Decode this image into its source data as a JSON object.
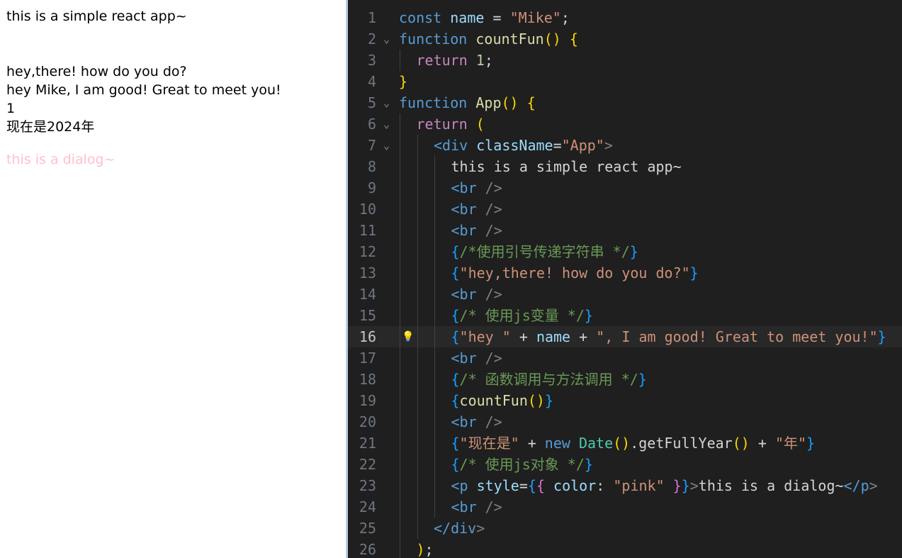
{
  "preview": {
    "line1": "this is a simple react app~",
    "line2": "hey,there! how do you do?",
    "line3": "hey Mike, I am good! Great to meet you!",
    "line4": "1",
    "line5": "现在是2024年",
    "dialog": "this is a dialog~",
    "dialog_color": "#ffc0cb"
  },
  "editor": {
    "active_line": 16,
    "lines": [
      {
        "n": "1",
        "t": "const name = \"Mike\";"
      },
      {
        "n": "2",
        "t": "function countFun() {"
      },
      {
        "n": "3",
        "t": "return 1;"
      },
      {
        "n": "4",
        "t": "}"
      },
      {
        "n": "5",
        "t": "function App() {"
      },
      {
        "n": "6",
        "t": "return ("
      },
      {
        "n": "7",
        "t": "<div className=\"App\">"
      },
      {
        "n": "8",
        "t": "this is a simple react app~"
      },
      {
        "n": "9",
        "t": "<br />"
      },
      {
        "n": "10",
        "t": "<br />"
      },
      {
        "n": "11",
        "t": "<br />"
      },
      {
        "n": "12",
        "t": "{/*使用引号传递字符串 */}"
      },
      {
        "n": "13",
        "t": "{\"hey,there! how do you do?\"}"
      },
      {
        "n": "14",
        "t": "<br />"
      },
      {
        "n": "15",
        "t": "{/* 使用js变量 */}"
      },
      {
        "n": "16",
        "t": "{\"hey \" + name + \", I am good! Great to meet you!\"}"
      },
      {
        "n": "17",
        "t": "<br />"
      },
      {
        "n": "18",
        "t": "{/* 函数调用与方法调用 */}"
      },
      {
        "n": "19",
        "t": "{countFun()}"
      },
      {
        "n": "20",
        "t": "<br />"
      },
      {
        "n": "21",
        "t": "{\"现在是\" + new Date().getFullYear() + \"年\"}"
      },
      {
        "n": "22",
        "t": "{/* 使用js对象 */}"
      },
      {
        "n": "23",
        "t": "<p style={{ color: \"pink\" }}>this is a dialog~</p>"
      },
      {
        "n": "24",
        "t": "<br />"
      },
      {
        "n": "25",
        "t": "</div>"
      },
      {
        "n": "26",
        "t": ");"
      }
    ]
  }
}
